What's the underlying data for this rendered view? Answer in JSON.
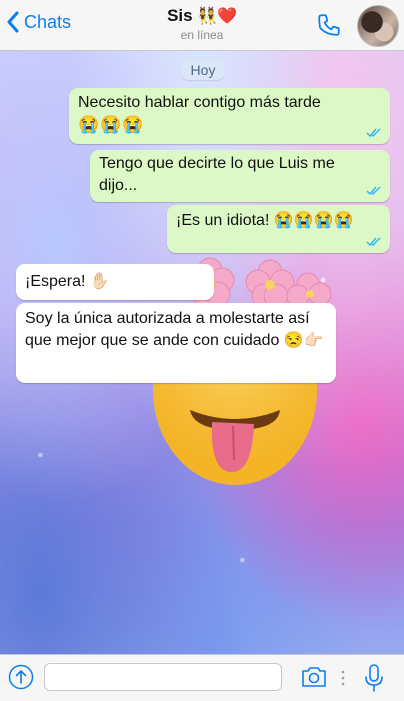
{
  "header": {
    "back_label": "Chats",
    "contact_name": "Sis",
    "contact_emoji": "👯❤️",
    "status": "en línea"
  },
  "date_chip": "Hoy",
  "messages": [
    {
      "text": "Necesito hablar contigo más tarde",
      "emojis": "😭😭😭",
      "direction": "outgoing"
    },
    {
      "text": "Tengo que decirte lo que Luis me dijo...",
      "direction": "outgoing"
    },
    {
      "text": "¡Es un idiota! 😭😭😭😭",
      "direction": "outgoing"
    },
    {
      "text": "¡Espera! ✋🏻",
      "direction": "incoming"
    },
    {
      "text": "Soy la única autorizada a molestarte así que mejor que se ande con cuidado 😒👉🏻",
      "direction": "incoming"
    }
  ],
  "composer": {
    "placeholder": ""
  },
  "colors": {
    "accent": "#0a7ef0",
    "outgoing_bubble": "#dcf8c6",
    "incoming_bubble": "#ffffff",
    "read_ticks": "#34b7f1"
  },
  "icons": [
    "chevron-left-icon",
    "phone-icon",
    "read-ticks-icon",
    "upload-arrow-icon",
    "camera-icon",
    "microphone-icon"
  ]
}
